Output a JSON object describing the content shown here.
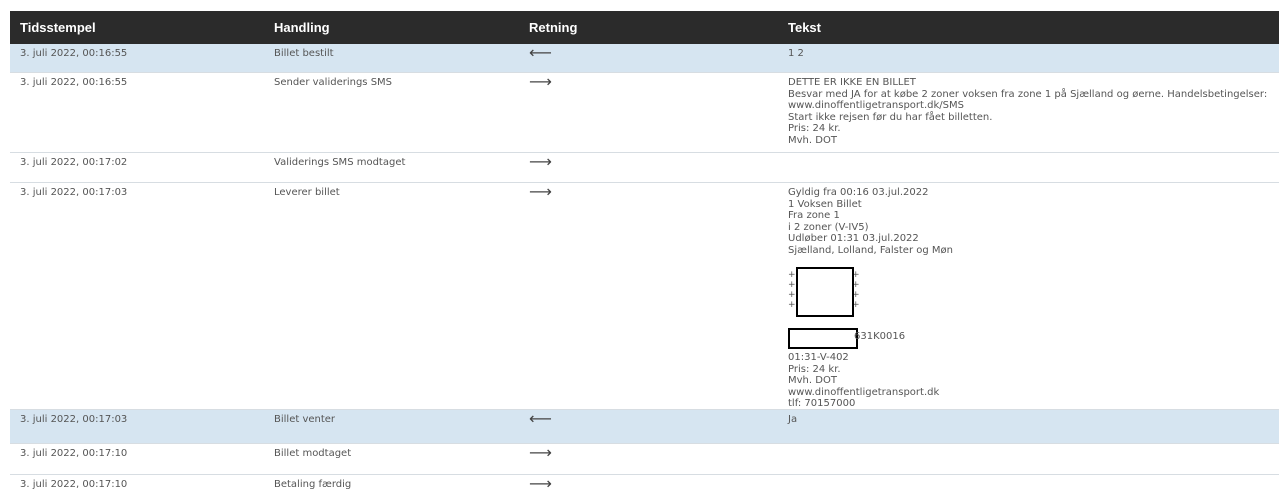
{
  "headers": {
    "timestamp": "Tidsstempel",
    "action": "Handling",
    "direction": "Retning",
    "text": "Tekst"
  },
  "rows": [
    {
      "timestamp": "3. juli 2022, 00:16:55",
      "action": "Billet bestilt",
      "direction": "⟵",
      "text": "1 2"
    },
    {
      "timestamp": "3. juli 2022, 00:16:55",
      "action": "Sender validerings SMS",
      "direction": "⟶",
      "text": "DETTE ER IKKE EN BILLET\nBesvar med JA for at købe 2 zoner voksen fra zone 1 på Sjælland og øerne. Handelsbetingelser:\nwww.dinoffentligetransport.dk/SMS\nStart ikke rejsen før du har fået billetten.\nPris: 24 kr.\nMvh. DOT"
    },
    {
      "timestamp": "3. juli 2022, 00:17:02",
      "action": "Validerings SMS modtaget",
      "direction": "⟶",
      "text": ""
    },
    {
      "timestamp": "3. juli 2022, 00:17:03",
      "action": "Leverer billet",
      "direction": "⟶",
      "text": "Gyldig fra 00:16 03.jul.2022\n1 Voksen Billet\nFra zone 1\ni 2 zoner (V-IV5)\nUdløber 01:31 03.jul.2022\nSjælland, Lolland, Falster og Møn",
      "code_suffix": "631K0016",
      "text_tail": "01:31-V-402\nPris: 24 kr.\nMvh. DOT\nwww.dinoffentligetransport.dk\ntlf: 70157000"
    },
    {
      "timestamp": "3. juli 2022, 00:17:03",
      "action": "Billet venter",
      "direction": "⟵",
      "text": "Ja"
    },
    {
      "timestamp": "3. juli 2022, 00:17:10",
      "action": "Billet modtaget",
      "direction": "⟶",
      "text": ""
    },
    {
      "timestamp": "3. juli 2022, 00:17:10",
      "action": "Betaling færdig",
      "direction": "⟶",
      "text": ""
    }
  ]
}
